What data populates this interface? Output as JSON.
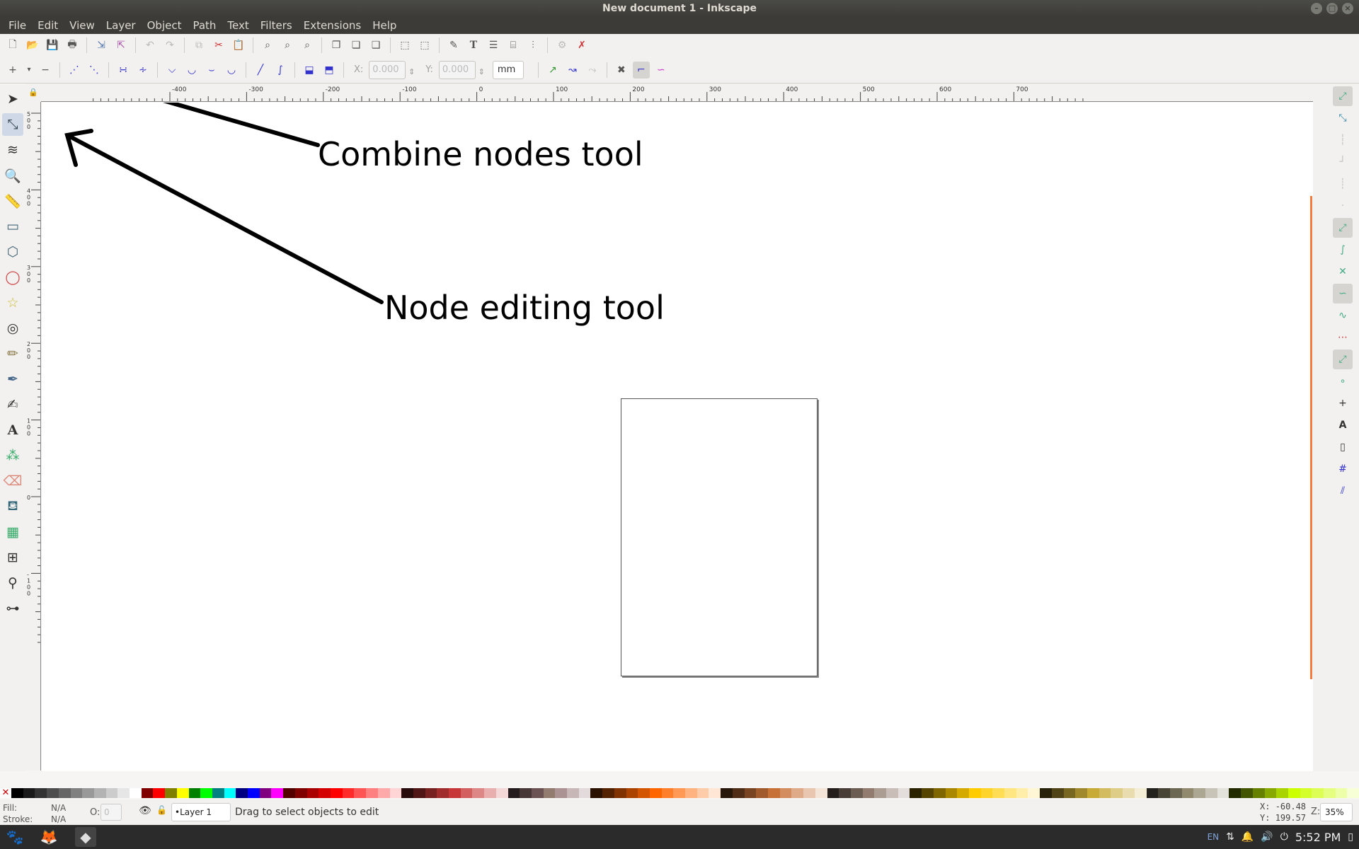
{
  "window": {
    "title": "New document 1 - Inkscape"
  },
  "menubar": {
    "items": [
      "File",
      "Edit",
      "View",
      "Layer",
      "Object",
      "Path",
      "Text",
      "Filters",
      "Extensions",
      "Help"
    ]
  },
  "node_toolbar": {
    "x_label": "X:",
    "x_value": "0.000",
    "y_label": "Y:",
    "y_value": "0.000",
    "unit": "mm"
  },
  "rulers": {
    "horizontal_labels": [
      "-400",
      "-300",
      "-200",
      "-100",
      "0",
      "100",
      "200",
      "300",
      "400",
      "500",
      "600",
      "700"
    ],
    "vertical_labels": [
      "500",
      "400",
      "300",
      "200",
      "100",
      "0",
      "-100"
    ]
  },
  "annotations": {
    "combine": "Combine nodes tool",
    "node_edit": "Node editing tool"
  },
  "status": {
    "fill_label": "Fill:",
    "fill_value": "N/A",
    "stroke_label": "Stroke:",
    "stroke_value": "N/A",
    "opacity_label": "O:",
    "opacity_value": "0",
    "layer": "•Layer 1",
    "message": "Drag to select objects to edit",
    "x_label": "X:",
    "x_value": "-60.48",
    "y_label": "Y:",
    "y_value": "199.57",
    "zoom_label": "Z:",
    "zoom_value": "35%"
  },
  "taskbar": {
    "keyboard": "EN",
    "clock": "5:52 PM"
  },
  "icons": {
    "toolbox": [
      "selector-arrow-icon",
      "node-editor-icon",
      "tweak-icon",
      "zoom-icon",
      "measure-icon",
      "rectangle-icon",
      "3d-box-icon",
      "ellipse-icon",
      "star-icon",
      "spiral-icon",
      "pencil-icon",
      "pen-icon",
      "calligraphy-icon",
      "text-icon",
      "spray-icon",
      "eraser-icon",
      "paint-bucket-icon",
      "gradient-icon",
      "mesh-icon",
      "dropper-icon",
      "connector-icon"
    ]
  },
  "colors": {
    "accent_orange": "#f47b3c",
    "palette": [
      "#000000",
      "#1a1a1a",
      "#333333",
      "#4d4d4d",
      "#666666",
      "#808080",
      "#999999",
      "#b3b3b3",
      "#cccccc",
      "#e6e6e6",
      "#ffffff",
      "#800000",
      "#ff0000",
      "#808000",
      "#ffff00",
      "#008000",
      "#00ff00",
      "#008080",
      "#00ffff",
      "#000080",
      "#0000ff",
      "#800080",
      "#ff00ff",
      "#550000",
      "#800000",
      "#aa0000",
      "#d40000",
      "#ff0000",
      "#ff2a2a",
      "#ff5555",
      "#ff8080",
      "#ffaaaa",
      "#ffd5d5",
      "#280b0b",
      "#501616",
      "#782121",
      "#a02c2c",
      "#c83737",
      "#d35f5f",
      "#de8787",
      "#e9afaf",
      "#f4d7d7",
      "#241c1c",
      "#483737",
      "#6c5353",
      "#917c6f",
      "#ac9393",
      "#c8b7b7",
      "#e3dbdb",
      "#2b1100",
      "#552200",
      "#803300",
      "#aa4400",
      "#d45500",
      "#ff6600",
      "#ff7f2a",
      "#ff9955",
      "#ffb380",
      "#ffccaa",
      "#ffe6d5",
      "#28170b",
      "#502d16",
      "#784421",
      "#a05a2c",
      "#c87137",
      "#d38d5f",
      "#deaa87",
      "#e9c6af",
      "#f4e3d7",
      "#241f1c",
      "#483e37",
      "#6c5d53",
      "#917c6f",
      "#ac9d93",
      "#c8beb7",
      "#e3dedb",
      "#2b2200",
      "#554400",
      "#806600",
      "#aa8800",
      "#d4aa00",
      "#ffcc00",
      "#ffd42a",
      "#ffdd55",
      "#ffe680",
      "#ffeeaa",
      "#fff6d5",
      "#28220b",
      "#504416",
      "#786721",
      "#a0892c",
      "#c8ab37",
      "#d3bc5f",
      "#decd87",
      "#e9ddaf",
      "#f4eed7",
      "#24221c",
      "#484537",
      "#6c6753",
      "#918a6f",
      "#aca793",
      "#c8c4b7",
      "#e3e2db",
      "#222b00",
      "#445500",
      "#668000",
      "#88aa00",
      "#aad400",
      "#ccff00",
      "#d4ff2a",
      "#ddff55",
      "#e5ff80",
      "#eeffaa",
      "#f6ffd5"
    ]
  }
}
